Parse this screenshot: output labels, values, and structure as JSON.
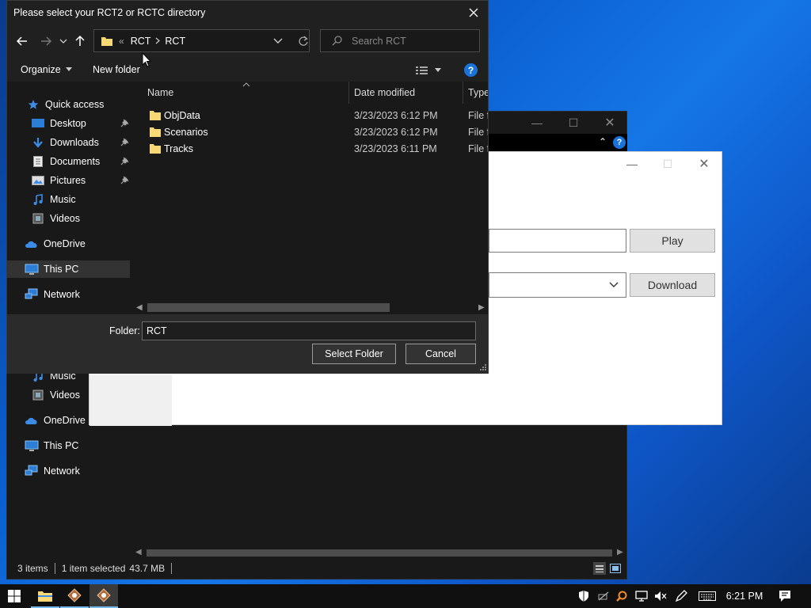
{
  "dialog": {
    "title": "Please select your RCT2 or RCTC directory",
    "breadcrumb": {
      "overflow": "«",
      "parent": "RCT",
      "current": "RCT"
    },
    "search_placeholder": "Search RCT",
    "toolbar": {
      "organize": "Organize",
      "new_folder": "New folder"
    },
    "nav": [
      {
        "label": "Quick access",
        "icon": "star-icon"
      },
      {
        "label": "Desktop",
        "icon": "desktop-icon",
        "pinned": true
      },
      {
        "label": "Downloads",
        "icon": "download-icon",
        "pinned": true
      },
      {
        "label": "Documents",
        "icon": "document-icon",
        "pinned": true
      },
      {
        "label": "Pictures",
        "icon": "picture-icon",
        "pinned": true
      },
      {
        "label": "Music",
        "icon": "music-icon"
      },
      {
        "label": "Videos",
        "icon": "video-icon"
      },
      {
        "label": "OneDrive",
        "icon": "cloud-icon"
      },
      {
        "label": "This PC",
        "icon": "computer-icon",
        "selected": true
      },
      {
        "label": "Network",
        "icon": "network-icon"
      }
    ],
    "columns": {
      "name": "Name",
      "date": "Date modified",
      "type": "Type"
    },
    "files": [
      {
        "name": "ObjData",
        "date": "3/23/2023 6:12 PM",
        "type": "File fo"
      },
      {
        "name": "Scenarios",
        "date": "3/23/2023 6:12 PM",
        "type": "File fo"
      },
      {
        "name": "Tracks",
        "date": "3/23/2023 6:11 PM",
        "type": "File fo"
      }
    ],
    "folder_label": "Folder:",
    "folder_value": "RCT",
    "select_button": "Select Folder",
    "cancel_button": "Cancel"
  },
  "bg_explorer": {
    "nav": [
      {
        "label": "Music",
        "icon": "music-icon"
      },
      {
        "label": "Videos",
        "icon": "video-icon"
      },
      {
        "label": "OneDrive",
        "icon": "cloud-icon"
      },
      {
        "label": "This PC",
        "icon": "computer-icon"
      },
      {
        "label": "Network",
        "icon": "network-icon"
      }
    ],
    "status": {
      "items": "3 items",
      "selected": "1 item selected",
      "size": "43.7 MB"
    }
  },
  "launcher": {
    "play_button": "Play",
    "download_button": "Download"
  },
  "taskbar": {
    "time": "6:21 PM"
  },
  "colors": {
    "accent": "#0078d7",
    "folder": "#f8d775",
    "dialog_bg": "#202020",
    "pane_bg": "#191919"
  }
}
